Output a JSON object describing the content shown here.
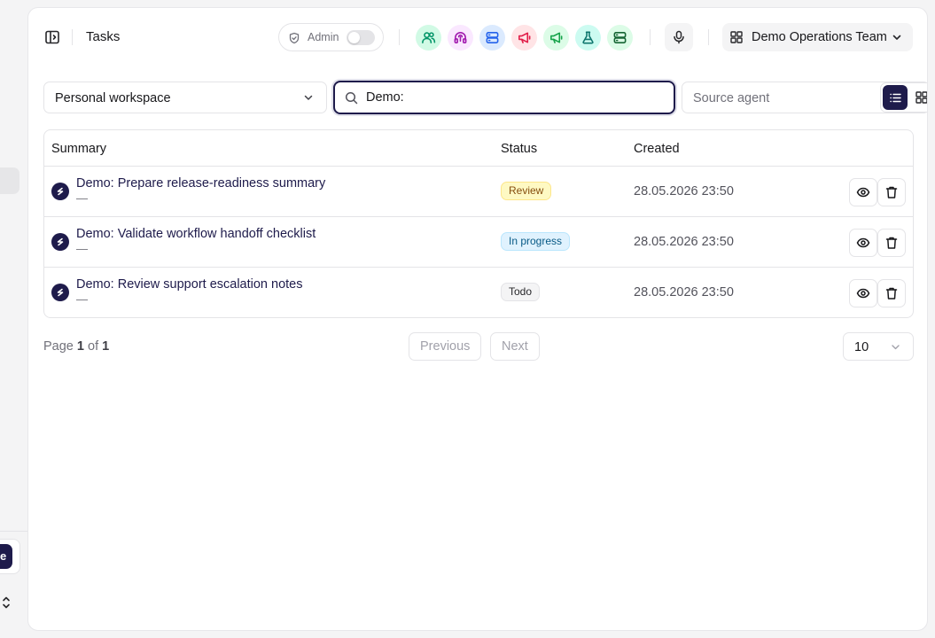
{
  "header": {
    "title": "Tasks",
    "admin_label": "Admin",
    "team_label": "Demo Operations Team",
    "agent_icons": [
      {
        "name": "users-icon",
        "bg": "#d1fae5",
        "fg": "#059669"
      },
      {
        "name": "headset-icon",
        "bg": "#fae8ff",
        "fg": "#a21caf"
      },
      {
        "name": "server-icon",
        "bg": "#dbeafe",
        "fg": "#2563eb"
      },
      {
        "name": "megaphone-icon",
        "bg": "#ffe4e6",
        "fg": "#e11d48"
      },
      {
        "name": "megaphone-icon",
        "bg": "#dcfce7",
        "fg": "#16a34a"
      },
      {
        "name": "flask-icon",
        "bg": "#ccfbf1",
        "fg": "#0f766e"
      },
      {
        "name": "server-icon",
        "bg": "#dcfce7",
        "fg": "#166534"
      }
    ]
  },
  "filters": {
    "workspace": "Personal workspace",
    "search_value": "Demo:",
    "source_placeholder": "Source agent"
  },
  "table": {
    "columns": [
      "Summary",
      "Status",
      "Created"
    ],
    "rows": [
      {
        "title": "Demo: Prepare release-readiness summary",
        "sub": "—",
        "status": "Review",
        "created": "28.05.2026 23:50"
      },
      {
        "title": "Demo: Validate workflow handoff checklist",
        "sub": "—",
        "status": "In progress",
        "created": "28.05.2026 23:50"
      },
      {
        "title": "Demo: Review support escalation notes",
        "sub": "—",
        "status": "Todo",
        "created": "28.05.2026 23:50"
      }
    ]
  },
  "pagination": {
    "page_word": "Page",
    "current": "1",
    "of_word": "of",
    "total": "1",
    "previous": "Previous",
    "next": "Next",
    "per_page": "10"
  },
  "sidebar": {
    "card_letter": "e"
  },
  "colors": {
    "accent": "#1e1b4b"
  }
}
